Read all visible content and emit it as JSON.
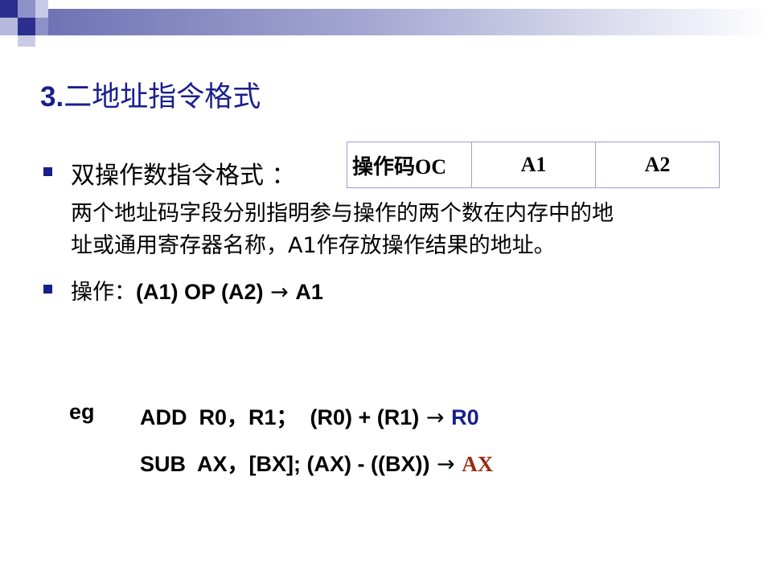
{
  "colors": {
    "title": "#1a1f8c",
    "accent_blue": "#1a1f8c",
    "accent_red": "#9b2a12"
  },
  "title": {
    "number": "3.",
    "text": "二地址指令格式"
  },
  "format_table": {
    "cells": [
      "操作码OC",
      "A1",
      "A2"
    ]
  },
  "bullets": [
    {
      "heading": "双操作数指令格式 ：",
      "lines": [
        "两个地址码字段分别指明参与操作的两个数在内存中的地",
        "址或通用寄存器名称，A1作存放操作结果的地址。"
      ]
    },
    {
      "prefix": "操作：",
      "expr": "(A1) OP (A2)",
      "arrow": "→",
      "result": "A1"
    }
  ],
  "examples": {
    "label": "eg",
    "items": [
      {
        "instr": "ADD  R0，R1；  (R0) + (R1)",
        "arrow": "→",
        "result": "R0"
      },
      {
        "instr": "SUB  AX，[BX]; (AX) - ((BX))",
        "arrow": "→",
        "result": "AX"
      }
    ]
  }
}
